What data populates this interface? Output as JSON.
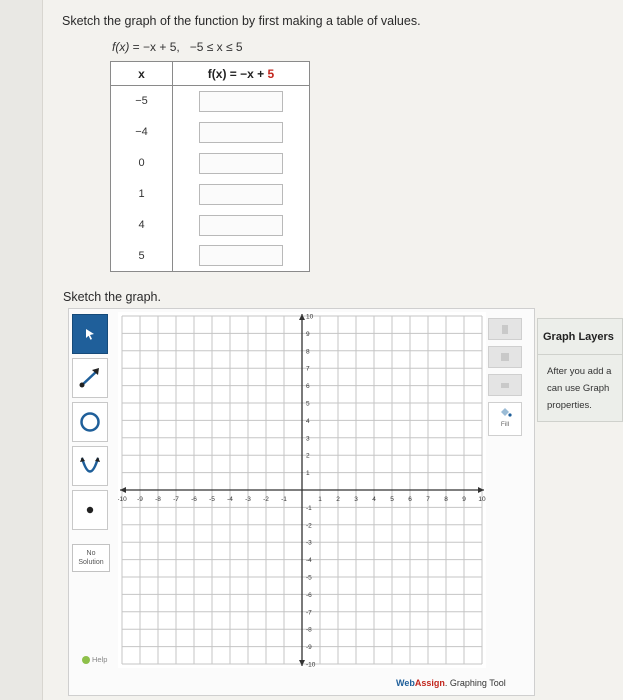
{
  "prompt": "Sketch the graph of the function by first making a table of values.",
  "function_line": {
    "name": "f(x)",
    "rule": " = −x + 5,",
    "domain": "   −5 ≤ x ≤ 5"
  },
  "table": {
    "headers": {
      "x": "x",
      "fx_prefix": "f(x) = −x + ",
      "fx_highlight": "5"
    },
    "rows": [
      {
        "x": "−5",
        "value": ""
      },
      {
        "x": "−4",
        "value": ""
      },
      {
        "x": "0",
        "value": ""
      },
      {
        "x": "1",
        "value": ""
      },
      {
        "x": "4",
        "value": ""
      },
      {
        "x": "5",
        "value": ""
      }
    ]
  },
  "sketch_label": "Sketch the graph.",
  "toolbar": {
    "tools": [
      "pointer-icon",
      "line-tool-icon",
      "circle-tool-icon",
      "parabola-tool-icon",
      "point-tool-icon"
    ],
    "no_solution": "No Solution",
    "help": "Help"
  },
  "graph": {
    "x_ticks": [
      "-10",
      "-9",
      "-8",
      "-7",
      "-6",
      "-5",
      "-4",
      "-3",
      "-2",
      "-1",
      "1",
      "2",
      "3",
      "4",
      "5",
      "6",
      "7",
      "8",
      "9",
      "10"
    ],
    "y_ticks": [
      "10",
      "9",
      "8",
      "7",
      "6",
      "5",
      "4",
      "3",
      "2",
      "1",
      "-1",
      "-2",
      "-3",
      "-4",
      "-5",
      "-6",
      "-7",
      "-8",
      "-9",
      "-10"
    ],
    "xlim": [
      -10,
      10
    ],
    "ylim": [
      -10,
      10
    ]
  },
  "side_tools": {
    "fill": "Fill"
  },
  "layers": {
    "title": "Graph Layers",
    "text": "After you add a\ncan use Graph\nproperties."
  },
  "brand": {
    "web": "Web",
    "assign": "Assign",
    "rest": ". Graphing Tool"
  },
  "colors": {
    "accent": "#1f5f9a",
    "highlight": "#c2261d"
  }
}
